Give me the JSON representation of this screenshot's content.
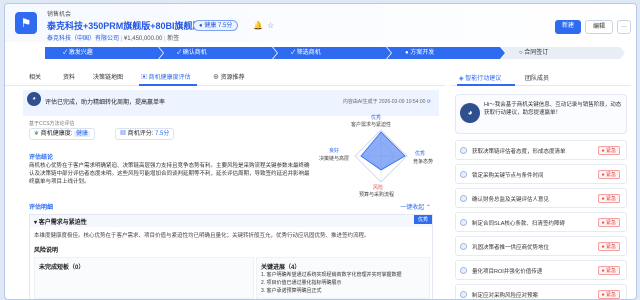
{
  "header": {
    "subtitle": "销售机会",
    "title": "泰克科技+350PRM旗舰版+80BI旗舰版",
    "company": "泰克科技（中国）有限公司",
    "amount": "¥1,450,000.00",
    "status": "新签",
    "health_tag": "健康",
    "health_score": "7.5分",
    "new_label": "新建",
    "edit_label": "编辑",
    "more_label": "···"
  },
  "stages": [
    "激发兴趣",
    "确认商机",
    "筛选商机",
    "方案开发",
    "合同签订"
  ],
  "tabs": [
    "相关",
    "资料",
    "决策链地图",
    "商机健康度评估",
    "资源推荐"
  ],
  "assessment": {
    "banner_text": "评估已完成，助力精细转化周期，提高赢单率",
    "banner_stamp": "内容由AI生成于 2026-03-09 10:54:00",
    "method": "基于CCS方法论评估",
    "health_label": "商机健康度:",
    "health_value": "健康",
    "score_label": "商机评分:",
    "score_value": "7.5分",
    "conclusion_title": "评估结论",
    "conclusion_text": "商机核心优势在于客户需求明确紧迫、决策链高层强力支持且竞争态势有利。主要风险是采购流程关键参数未最终确认及决策链中部分评估者态度未明。这些风险可能增加合同谈判延期等不利，延长评估周期，导致签约延迟并影响最终赢单与项目上线计划。",
    "radar": {
      "top": "优秀",
      "top_sub": "客户需求与紧迫性",
      "left": "良好",
      "left_sub": "决策链与高层",
      "right": "优秀",
      "right_sub": "竞争态势",
      "bottom": "风险",
      "bottom_sub": "预算与采购流程"
    },
    "detail_title": "评估明细",
    "collapse_label": "一键收起",
    "item_title": "客户需求与紧迫性",
    "item_badge": "优秀",
    "item_text": "本维度健康度极佳。核心优势在于客户需求、项目价值与紧迫性均已明确且量化；关键转折般互允，优秀行动应巩固优势、推进签约流程。",
    "risk_title": "风险说明",
    "undone_label": "未完成短板（0）",
    "progress_title": "关键进展（4）",
    "progress_items": [
      "1. 客户明确希望通过系统实现经销商数字化管理并实时掌握数据",
      "2. 项目价值已通过量化指标明确展示",
      "3. 客户承诺预算明确且正式"
    ]
  },
  "right_panel": {
    "tab_active": "智能行动建议",
    "tab_other": "团队成员",
    "banner": "Hi～我会基于商机关键信息、互动记录与销售阶段，动态获取行动建议，助您提速赢单！",
    "badge_label": "紧急",
    "items": [
      "获取决策链评估者态度，形成态度清单",
      "锁定采购关键节点与条件时间",
      "确认财务总监及关键评估人意见",
      "制定合同SLA核心条款、扫清签约障碍",
      "巩固决策者推一供应商优势地位",
      "量化项目ROI并强化价值传递",
      "制定应对采购风险应对预案"
    ]
  }
}
